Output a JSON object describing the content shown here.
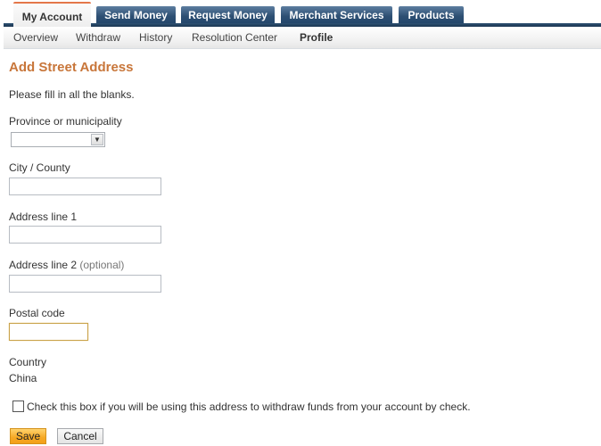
{
  "tabs": [
    {
      "label": "My Account",
      "active": true
    },
    {
      "label": "Send Money",
      "active": false
    },
    {
      "label": "Request Money",
      "active": false
    },
    {
      "label": "Merchant Services",
      "active": false
    },
    {
      "label": "Products",
      "active": false
    }
  ],
  "subnav": [
    {
      "label": "Overview"
    },
    {
      "label": "Withdraw"
    },
    {
      "label": "History"
    },
    {
      "label": "Resolution Center"
    },
    {
      "label": "Profile",
      "current": true
    }
  ],
  "page": {
    "title": "Add Street Address",
    "intro": "Please fill in all the blanks."
  },
  "form": {
    "province": {
      "label": "Province or municipality",
      "selected": "",
      "icon": "chevron-down-icon"
    },
    "city": {
      "label": "City / County",
      "value": ""
    },
    "address1": {
      "label": "Address line 1",
      "value": ""
    },
    "address2": {
      "label": "Address line 2",
      "optional": "(optional)",
      "value": ""
    },
    "postal": {
      "label": "Postal code",
      "value": ""
    },
    "country": {
      "label": "Country",
      "value": "China"
    },
    "withdraw_check": {
      "label": "Check this box if you will be using this address to withdraw funds from your account by check.",
      "checked": false
    }
  },
  "buttons": {
    "save": "Save",
    "cancel": "Cancel"
  },
  "colors": {
    "tab_blue": "#2d4f73",
    "active_tab_accent": "#e4774a",
    "title_orange": "#c8763a",
    "save_button": "#f6a823"
  }
}
